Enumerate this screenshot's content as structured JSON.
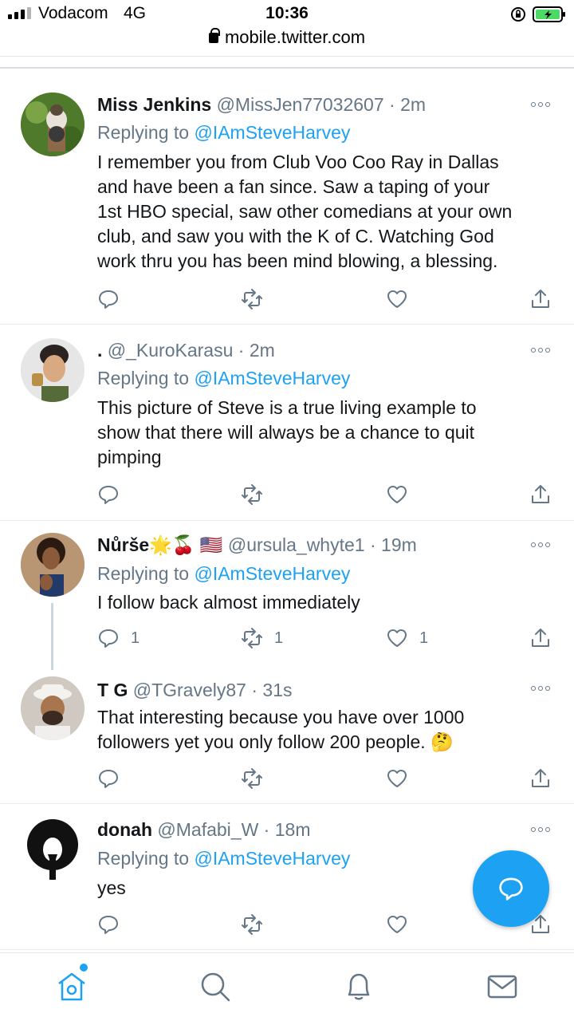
{
  "status_bar": {
    "carrier": "Vodacom",
    "network": "4G",
    "time": "10:36",
    "url": "mobile.twitter.com"
  },
  "tweets": [
    {
      "name": "Miss Jenkins",
      "handle": "@MissJen77032607",
      "separator": "·",
      "time": "2m",
      "replying_prefix": "Replying to",
      "replying_to": "@IAmSteveHarvey",
      "text_lines": [
        "I remember you from Club Voo Coo Ray in Dallas",
        "and have been a fan since. Saw a taping of your",
        "1st HBO special, saw other comedians at your own",
        "club, and saw you with the K of C. Watching God",
        "work thru you has been mind blowing, a blessing."
      ],
      "counts": {
        "reply": "",
        "retweet": "",
        "like": ""
      }
    },
    {
      "name": ".",
      "handle": "@_KuroKarasu",
      "separator": "·",
      "time": "2m",
      "replying_prefix": "Replying to",
      "replying_to": "@IAmSteveHarvey",
      "text_lines": [
        "This picture of Steve is a true living example to",
        "show that there will always be a chance to quit",
        "pimping"
      ],
      "counts": {
        "reply": "",
        "retweet": "",
        "like": ""
      }
    },
    {
      "name": "Nůrše",
      "name_emoji": "🌟🍒 🇺🇸",
      "handle": "@ursula_whyte1",
      "separator": "·",
      "time": "19m",
      "replying_prefix": "Replying to",
      "replying_to": "@IAmSteveHarvey",
      "text_lines": [
        "I follow back almost immediately"
      ],
      "counts": {
        "reply": "1",
        "retweet": "1",
        "like": "1"
      }
    },
    {
      "name": "T G",
      "handle": "@TGravely87",
      "separator": "·",
      "time": "31s",
      "text_lines": [
        "That interesting because you have over 1000",
        "followers yet you only follow 200 people. 🤔"
      ],
      "counts": {
        "reply": "",
        "retweet": "",
        "like": ""
      }
    },
    {
      "name": "donah",
      "handle": "@Mafabi_W",
      "separator": "·",
      "time": "18m",
      "replying_prefix": "Replying to",
      "replying_to": "@IAmSteveHarvey",
      "text_lines": [
        "yes"
      ],
      "counts": {
        "reply": "",
        "retweet": "",
        "like": ""
      }
    }
  ],
  "colors": {
    "accent": "#1da1f2",
    "muted": "#657786",
    "text": "#14171a",
    "battery_green": "#4cd964"
  },
  "icons": [
    "reply-icon",
    "retweet-icon",
    "like-icon",
    "share-icon",
    "more-icon",
    "compose-reply-icon",
    "home-icon",
    "search-icon",
    "notifications-icon",
    "messages-icon"
  ]
}
